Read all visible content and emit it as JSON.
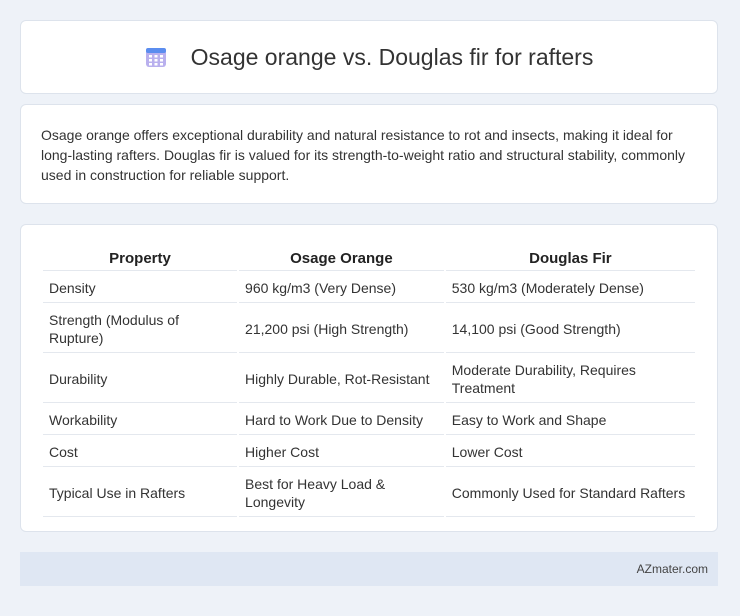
{
  "header": {
    "title": "Osage orange vs. Douglas fir for rafters",
    "icon": "calendar-icon"
  },
  "summary": {
    "text": "Osage orange offers exceptional durability and natural resistance to rot and insects, making it ideal for long-lasting rafters. Douglas fir is valued for its strength-to-weight ratio and structural stability, commonly used in construction for reliable support."
  },
  "table": {
    "headers": [
      "Property",
      "Osage Orange",
      "Douglas Fir"
    ],
    "rows": [
      [
        "Density",
        "960 kg/m3 (Very Dense)",
        "530 kg/m3 (Moderately Dense)"
      ],
      [
        "Strength (Modulus of Rupture)",
        "21,200 psi (High Strength)",
        "14,100 psi (Good Strength)"
      ],
      [
        "Durability",
        "Highly Durable, Rot-Resistant",
        "Moderate Durability, Requires Treatment"
      ],
      [
        "Workability",
        "Hard to Work Due to Density",
        "Easy to Work and Shape"
      ],
      [
        "Cost",
        "Higher Cost",
        "Lower Cost"
      ],
      [
        "Typical Use in Rafters",
        "Best for Heavy Load & Longevity",
        "Commonly Used for Standard Rafters"
      ]
    ]
  },
  "footer": {
    "site": "AZmater.com"
  },
  "colors": {
    "background": "#eef2f8",
    "card": "#ffffff",
    "footer": "#dfe7f3",
    "icon_primary": "#8b7fd8",
    "icon_top": "#5b8def"
  }
}
